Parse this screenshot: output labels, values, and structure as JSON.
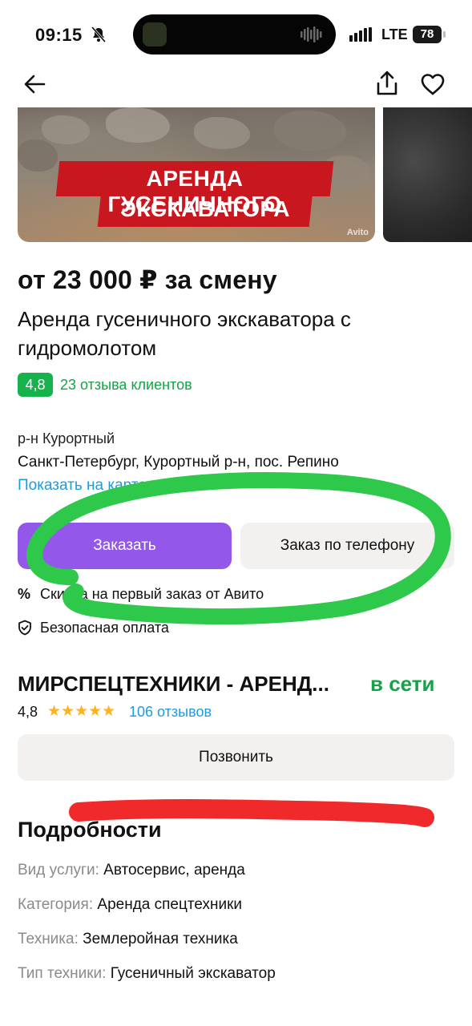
{
  "status_bar": {
    "time": "09:15",
    "network": "LTE",
    "battery": "78"
  },
  "nav": {
    "back_icon": "arrow-left-icon",
    "share_icon": "share-icon",
    "favorite_icon": "heart-icon"
  },
  "gallery": {
    "banner_line1": "АРЕНДА ГУСЕНИЧНОГО",
    "banner_line2": "ЭКСКАВАТОРА",
    "watermark": "Avito"
  },
  "listing": {
    "price": "от 23 000 ₽ за смену",
    "title": "Аренда гусеничного экскаватора с гидромолотом",
    "rating": "4,8",
    "reviews_link": "23 отзыва клиентов",
    "district": "р-н Курортный",
    "address": "Санкт-Петербург, Курортный р-н, пос. Репино",
    "map_link": "Показать на карте"
  },
  "actions": {
    "order_label": "Заказать",
    "phone_order_label": "Заказ по телефону",
    "discount_text": "Скидка на первый заказ от Авито",
    "safe_payment_text": "Безопасная оплата"
  },
  "seller": {
    "name": "МИРСПЕЦТЕХНИКИ - АРЕНД...",
    "status": "в сети",
    "rating": "4,8",
    "stars": 5,
    "reviews": "106 отзывов",
    "call_label": "Позвонить"
  },
  "details": {
    "heading": "Подробности",
    "rows": [
      {
        "key": "Вид услуги:",
        "value": "Автосервис, аренда"
      },
      {
        "key": "Категория:",
        "value": "Аренда спецтехники"
      },
      {
        "key": "Техника:",
        "value": "Землеройная техника"
      },
      {
        "key": "Тип техники:",
        "value": "Гусеничный экскаватор"
      }
    ]
  },
  "colors": {
    "accent_purple": "#9357ea",
    "rating_green": "#16b24b",
    "link_blue": "#1e9be0",
    "annotation_green": "#2ec84a",
    "annotation_red": "#f02a2a"
  }
}
